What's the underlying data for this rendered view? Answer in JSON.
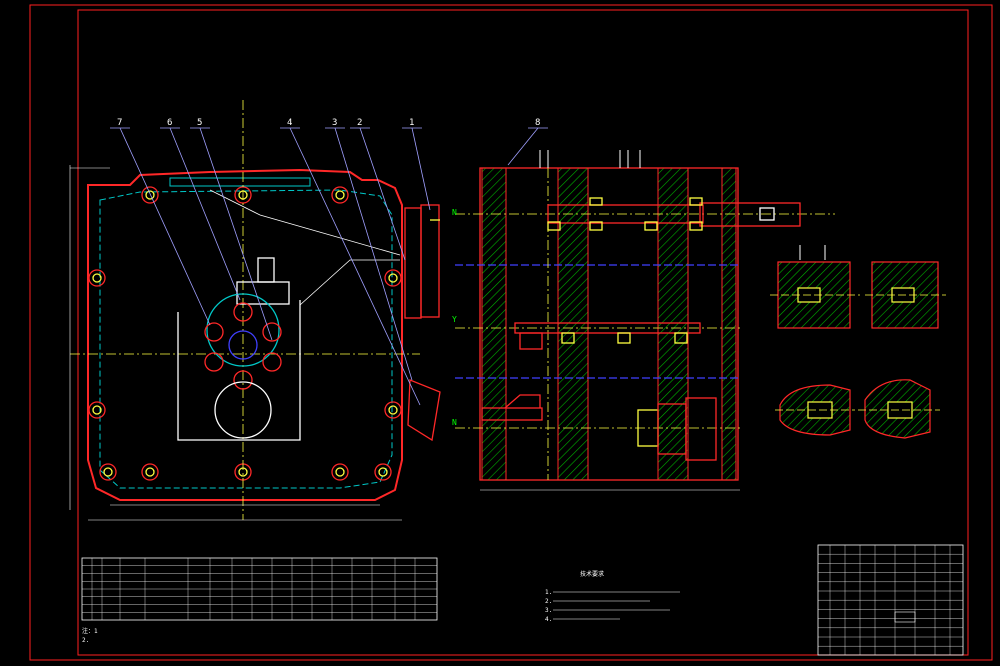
{
  "drawing": {
    "background": "#000000",
    "colors": {
      "frame": "#ff2020",
      "outline": "#ff2828",
      "hidden": "#00c8c8",
      "center": "#ffff40",
      "leader": "#a0a0ff",
      "hatch": "#00b000",
      "text": "#ffffff",
      "dim": "#40ff40",
      "blue": "#4040ff"
    },
    "balloons": [
      "7",
      "6",
      "5",
      "4",
      "3",
      "2",
      "1",
      "8"
    ],
    "right_side_tags": [
      "N",
      "Y",
      "N"
    ],
    "param_table_title": "",
    "notes_title": "技术要求",
    "notes_lines": [
      "1.",
      "2.",
      "3.",
      "4."
    ],
    "bottom_notes": [
      "注：1",
      "2."
    ],
    "detail_caption_1": "",
    "detail_caption_2": "",
    "title_block": {
      "part_name": "",
      "rows": [
        "",
        "",
        "",
        "",
        "",
        ""
      ]
    }
  }
}
